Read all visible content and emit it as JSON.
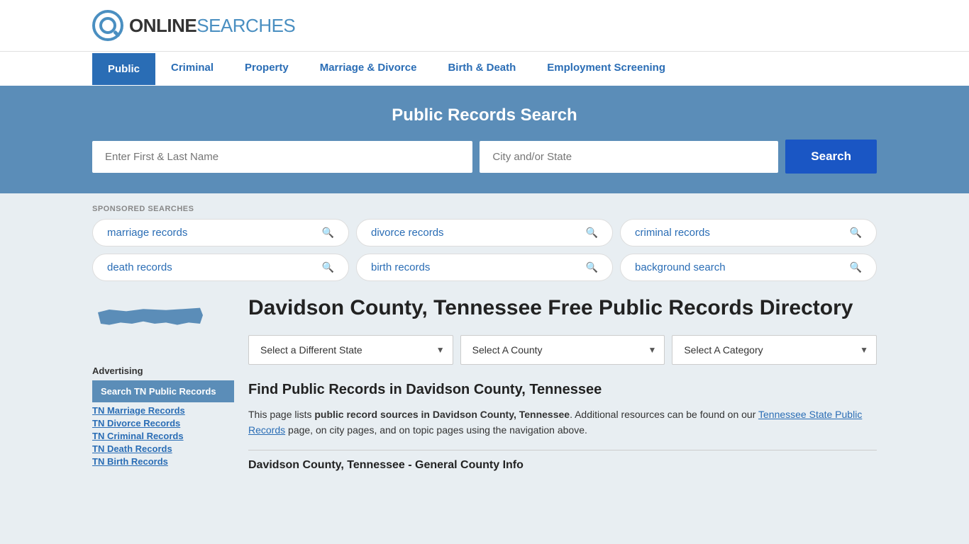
{
  "logo": {
    "online": "ONLINE",
    "searches": "SEARCHES"
  },
  "nav": {
    "items": [
      {
        "label": "Public",
        "active": true
      },
      {
        "label": "Criminal",
        "active": false
      },
      {
        "label": "Property",
        "active": false
      },
      {
        "label": "Marriage & Divorce",
        "active": false
      },
      {
        "label": "Birth & Death",
        "active": false
      },
      {
        "label": "Employment Screening",
        "active": false
      }
    ]
  },
  "search_banner": {
    "title": "Public Records Search",
    "name_placeholder": "Enter First & Last Name",
    "location_placeholder": "City and/or State",
    "button_label": "Search"
  },
  "sponsored": {
    "label": "SPONSORED SEARCHES",
    "tags": [
      {
        "text": "marriage records"
      },
      {
        "text": "divorce records"
      },
      {
        "text": "criminal records"
      },
      {
        "text": "death records"
      },
      {
        "text": "birth records"
      },
      {
        "text": "background search"
      }
    ]
  },
  "sidebar": {
    "advertising_label": "Advertising",
    "ad_highlight": "Search TN Public Records",
    "links": [
      "TN Marriage Records",
      "TN Divorce Records",
      "TN Criminal Records",
      "TN Death Records",
      "TN Birth Records"
    ]
  },
  "main": {
    "page_title": "Davidson County, Tennessee Free Public Records Directory",
    "dropdowns": {
      "state": "Select a Different State",
      "county": "Select A County",
      "category": "Select A Category"
    },
    "find_title": "Find Public Records in Davidson County, Tennessee",
    "find_desc_1": "This page lists ",
    "find_desc_bold": "public record sources in Davidson County, Tennessee",
    "find_desc_2": ". Additional resources can be found on our ",
    "find_desc_link": "Tennessee State Public Records",
    "find_desc_3": " page, on city pages, and on topic pages using the navigation above.",
    "county_info_title": "Davidson County, Tennessee - General County Info"
  }
}
